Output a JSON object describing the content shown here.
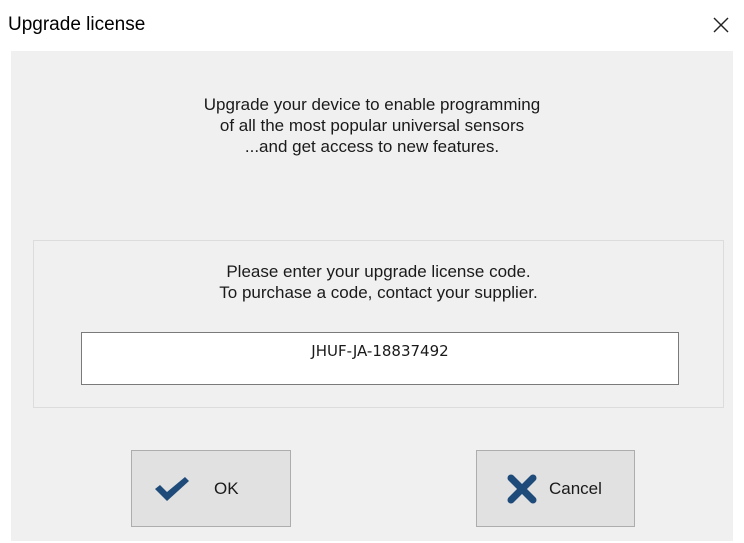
{
  "window": {
    "title": "Upgrade license",
    "close_icon": "close-icon"
  },
  "intro": {
    "lines": [
      "Upgrade your device to enable programming",
      "of all the most popular universal sensors",
      "...and get access to new features."
    ]
  },
  "license": {
    "lines": [
      "Please enter your upgrade license code.",
      "To purchase a code, contact your supplier."
    ],
    "code_value": "JHUF-JA-18837492"
  },
  "buttons": {
    "ok_label": "OK",
    "ok_icon": "checkmark-icon",
    "cancel_label": "Cancel",
    "cancel_icon": "cross-icon"
  },
  "colors": {
    "dialog_background": "#f0f0f0",
    "button_face": "#e1e1e1",
    "icon_blue": "#1f4b7a"
  }
}
